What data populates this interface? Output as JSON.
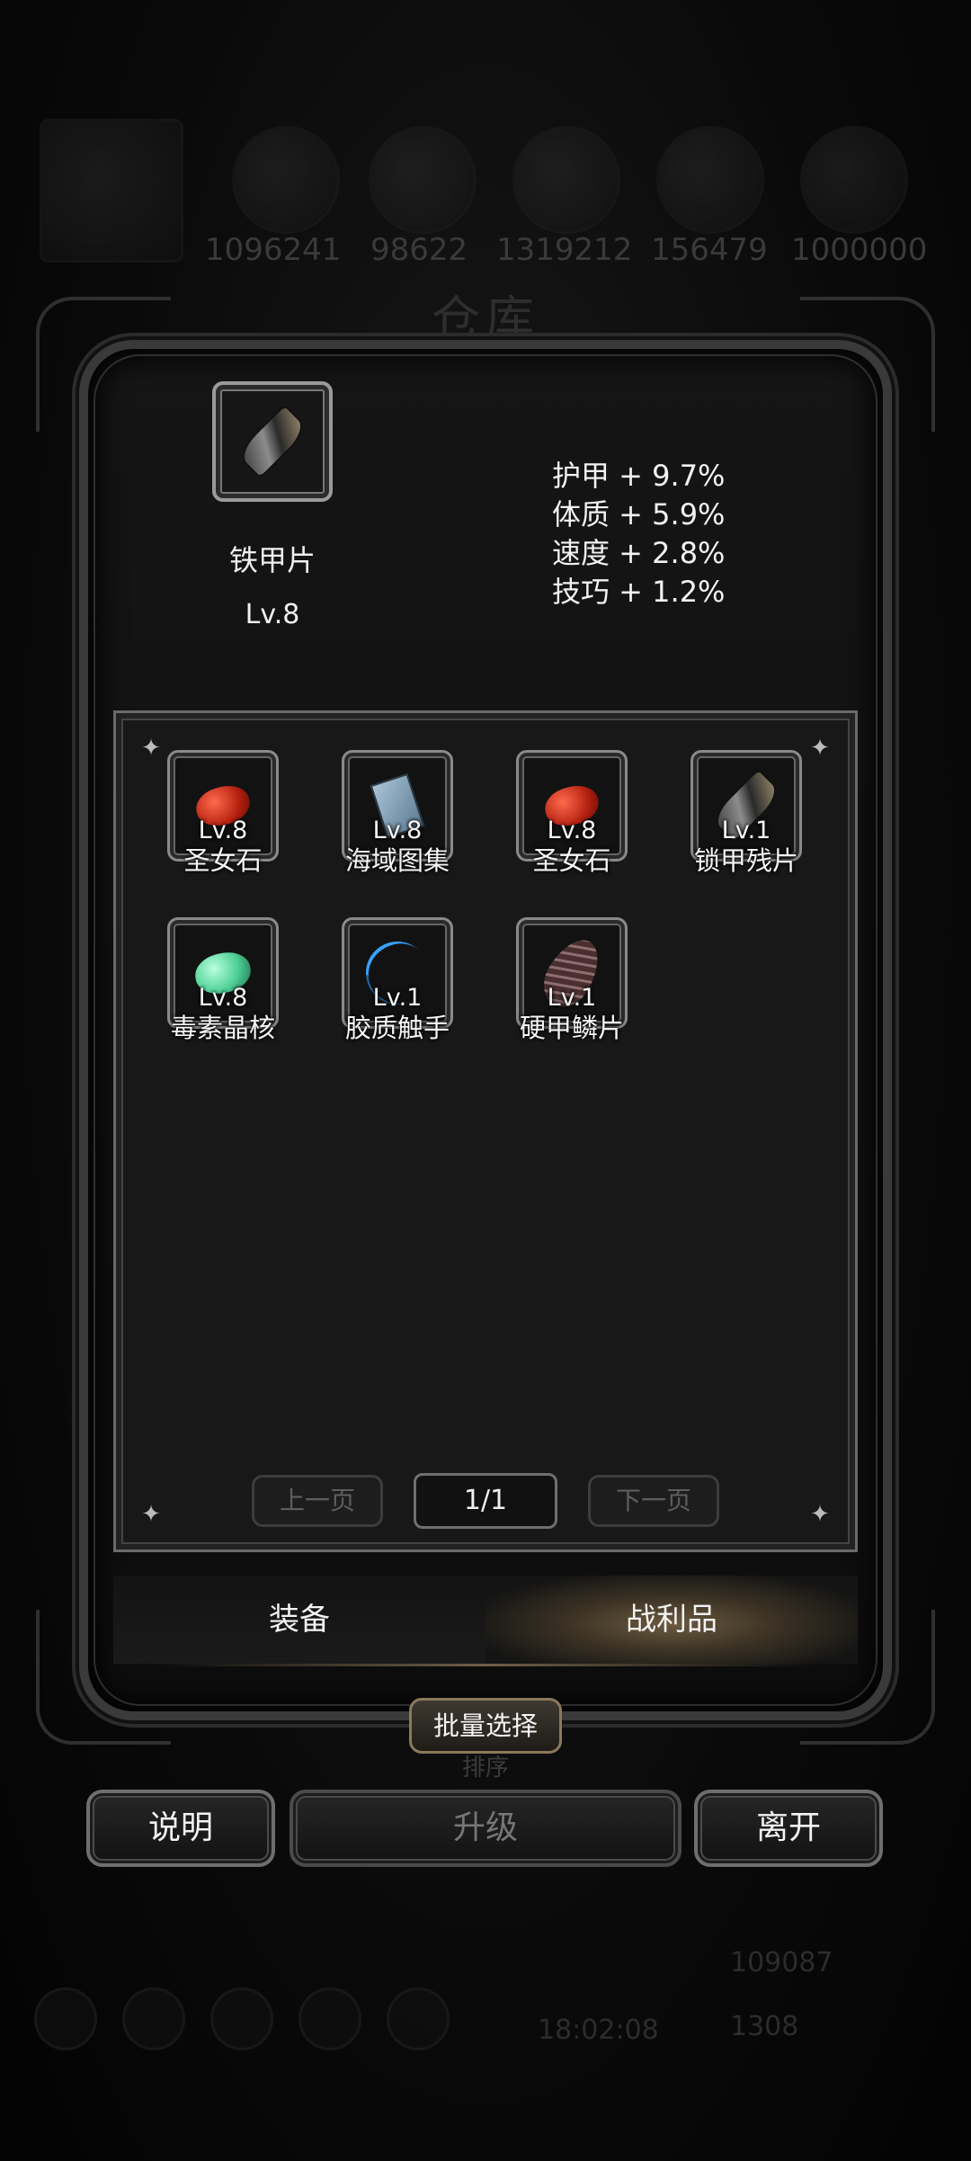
{
  "background": {
    "title": "仓库",
    "resources": [
      "1096241",
      "98622",
      "1319212",
      "156479",
      "1000000"
    ],
    "time": "18:02:08",
    "currency_a": "109087",
    "currency_b": "1308"
  },
  "detail": {
    "name": "铁甲片",
    "level": "Lv.8",
    "stats": [
      "护甲 + 9.7%",
      "体质 + 5.9%",
      "速度 + 2.8%",
      "技巧 + 1.2%"
    ]
  },
  "inventory": [
    {
      "name": "圣女石",
      "level": "Lv.8",
      "icon": "red-gem-icon"
    },
    {
      "name": "海域图集",
      "level": "Lv.8",
      "icon": "book-icon"
    },
    {
      "name": "圣女石",
      "level": "Lv.8",
      "icon": "red-gem-icon"
    },
    {
      "name": "锁甲残片",
      "level": "Lv.1",
      "icon": "armor-fragment-icon"
    },
    {
      "name": "毒素晶核",
      "level": "Lv.8",
      "icon": "green-gem-icon"
    },
    {
      "name": "胶质触手",
      "level": "Lv.1",
      "icon": "tentacle-icon"
    },
    {
      "name": "硬甲鳞片",
      "level": "Lv.1",
      "icon": "scale-icon"
    }
  ],
  "pager": {
    "prev": "上一页",
    "page": "1/1",
    "next": "下一页"
  },
  "tabs": {
    "equip": "装备",
    "loot": "战利品"
  },
  "buttons": {
    "batch": "批量选择",
    "sort": "排序",
    "help": "说明",
    "upgrade": "升级",
    "leave": "离开"
  }
}
